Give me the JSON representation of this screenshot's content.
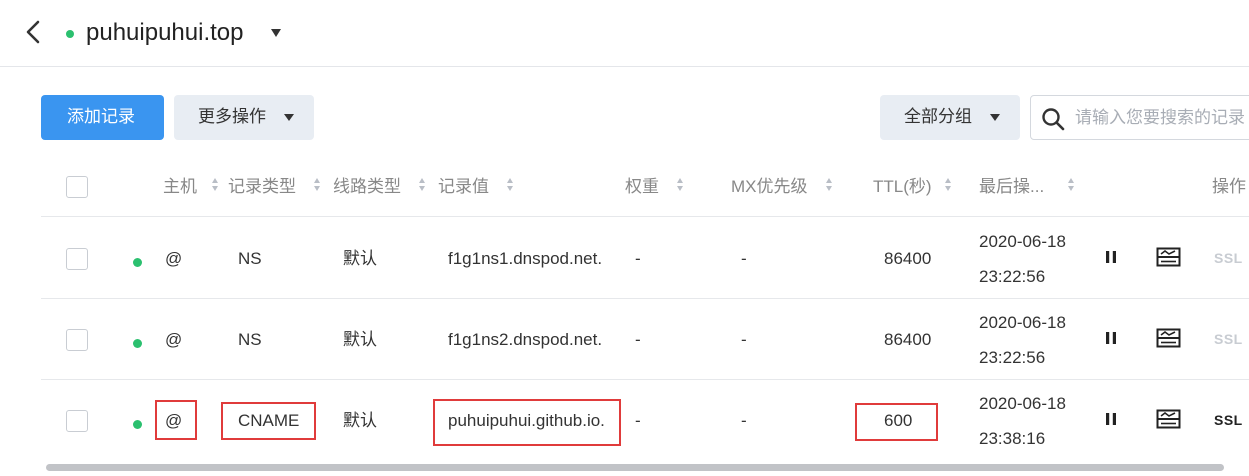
{
  "header": {
    "domain": "puhuipuhui.top"
  },
  "toolbar": {
    "add_record": "添加记录",
    "more_actions": "更多操作",
    "all_groups": "全部分组",
    "search_placeholder": "请输入您要搜索的记录"
  },
  "columns": {
    "host": "主机",
    "record_type": "记录类型",
    "line_type": "线路类型",
    "record_value": "记录值",
    "weight": "权重",
    "mx_priority": "MX优先级",
    "ttl": "TTL(秒)",
    "last_op": "最后操...",
    "actions": "操作"
  },
  "rows": [
    {
      "host": "@",
      "type": "NS",
      "line": "默认",
      "value": "f1g1ns1.dnspod.net.",
      "weight": "-",
      "mx": "-",
      "ttl": "86400",
      "date": "2020-06-18",
      "time": "23:22:56",
      "ssl": "SSL",
      "ssl_enabled": false
    },
    {
      "host": "@",
      "type": "NS",
      "line": "默认",
      "value": "f1g1ns2.dnspod.net.",
      "weight": "-",
      "mx": "-",
      "ttl": "86400",
      "date": "2020-06-18",
      "time": "23:22:56",
      "ssl": "SSL",
      "ssl_enabled": false
    },
    {
      "host": "@",
      "type": "CNAME",
      "line": "默认",
      "value": "puhuipuhui.github.io.",
      "weight": "-",
      "mx": "-",
      "ttl": "600",
      "date": "2020-06-18",
      "time": "23:38:16",
      "ssl": "SSL",
      "ssl_enabled": true
    }
  ],
  "colors": {
    "primary": "#3a95f0",
    "status_ok": "#2bc06f",
    "highlight": "#e03b3b",
    "ssl_disabled": "#c8ccd2",
    "ssl_enabled": "#222222"
  },
  "icons": {
    "back": "chevron-left-icon",
    "search": "search-icon",
    "pause": "pause-icon",
    "remark": "remark-icon"
  }
}
